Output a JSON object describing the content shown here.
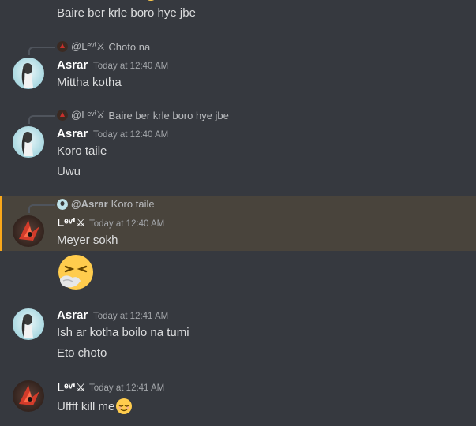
{
  "messages": {
    "top_text": "Baire ber krle boro hye jbe",
    "m1": {
      "reply_name": "@Lᵉᵛⁱ⚔",
      "reply_text": "Choto na",
      "author": "Asrar",
      "time": "Today at 12:40 AM",
      "lines": [
        "Mittha kotha"
      ]
    },
    "m2": {
      "reply_name": "@Lᵉᵛⁱ⚔",
      "reply_text": "Baire ber krle boro hye jbe",
      "author": "Asrar",
      "time": "Today at 12:40 AM",
      "lines": [
        "Koro taile",
        "Uwu"
      ]
    },
    "m3": {
      "reply_name": "@Asrar",
      "reply_text": "Koro taile",
      "author": "Lᵉᵛⁱ⚔",
      "time": "Today at 12:40 AM",
      "lines": [
        "Meyer sokh"
      ],
      "emoji": "sneezing-face"
    },
    "m4": {
      "author": "Asrar",
      "time": "Today at 12:41 AM",
      "lines": [
        "Ish ar kotha boilo na tumi",
        "Eto choto"
      ]
    },
    "m5": {
      "author": "Lᵉᵛⁱ⚔",
      "time": "Today at 12:41 AM",
      "lines": [
        "Uffff kill me"
      ],
      "emoji": "relieved-face"
    }
  },
  "colors": {
    "background": "#36393f",
    "highlight": "#49443c",
    "highlight_bar": "#faa81a",
    "text": "#dcddde",
    "timestamp": "#a3a6aa"
  }
}
